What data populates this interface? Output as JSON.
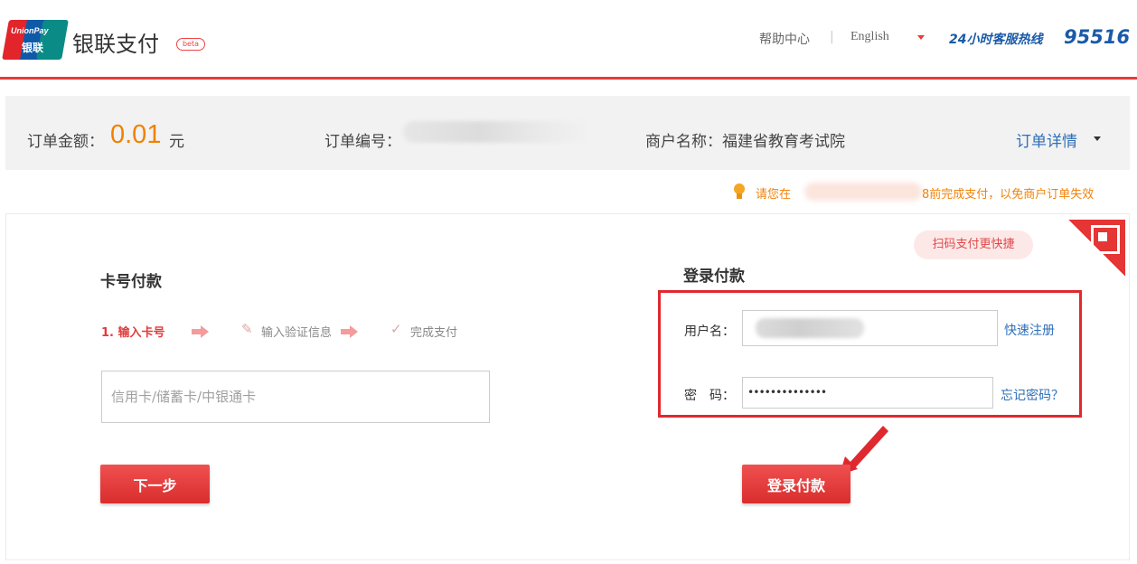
{
  "header": {
    "logo_text_en": "UnionPay",
    "logo_text_cn": "银联",
    "brand": "银联支付",
    "beta_badge": "beta",
    "help": "帮助中心",
    "separator": "|",
    "language": "English",
    "hotline_label": "24小时客服热线",
    "hotline_number": "95516"
  },
  "order": {
    "amount_label": "订单金额：",
    "amount_value": "0.01",
    "amount_unit": "元",
    "order_no_label": "订单编号：",
    "merchant": "商户名称：福建省教育考试院",
    "details": "订单详情"
  },
  "notice": {
    "prefix": "请您在",
    "suffix": "8前完成支付，以免商户订单失效"
  },
  "card_pay": {
    "title": "卡号付款",
    "steps": [
      "1. 输入卡号",
      "输入验证信息",
      "完成支付"
    ],
    "input_placeholder": "信用卡/储蓄卡/中银通卡",
    "next_button": "下一步"
  },
  "login_pay": {
    "qr_badge": "扫码支付更快捷",
    "title": "登录付款",
    "username_label": "用户名：",
    "password_label": "密　码：",
    "password_value": "••••••••••••••",
    "register_link": "快速注册",
    "forgot_link": "忘记密码？",
    "submit_button": "登录付款"
  },
  "colors": {
    "accent_red": "#e0292f",
    "amount_orange": "#f08200",
    "link_blue": "#2f6fb8",
    "hotline_blue": "#1a5aa8"
  }
}
